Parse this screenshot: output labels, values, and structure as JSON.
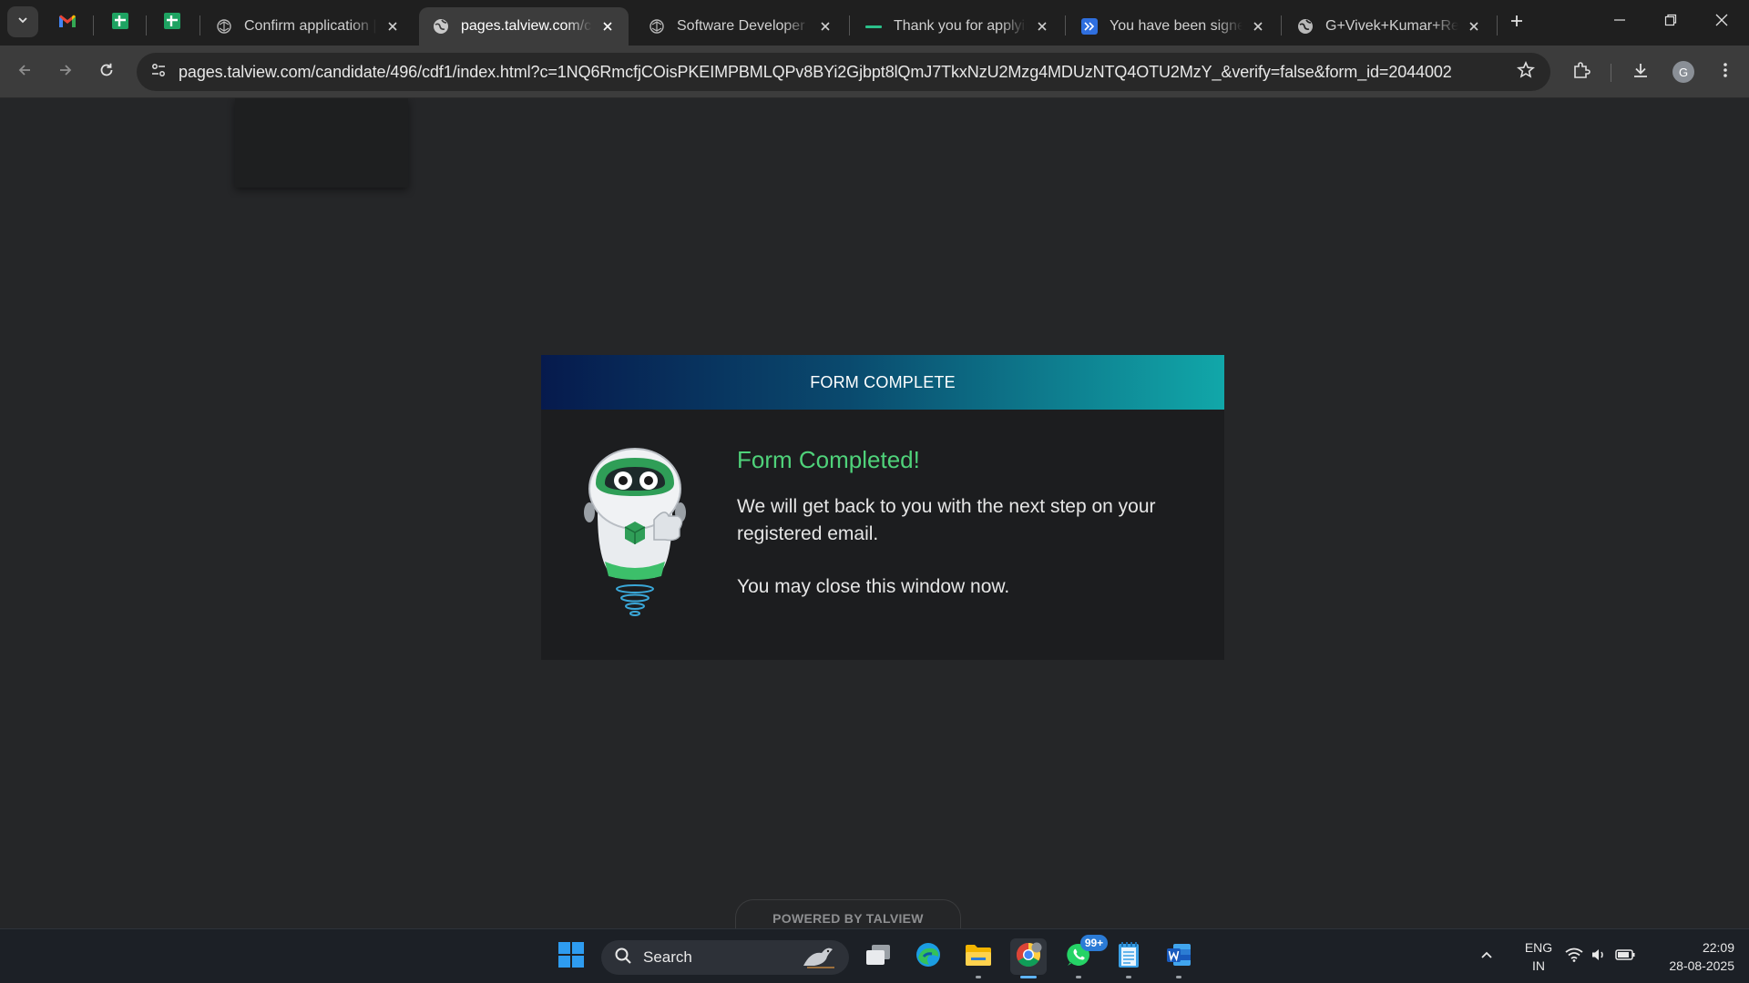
{
  "browser": {
    "tabs": [
      {
        "title": "Confirm application | I",
        "favicon": "brain-network-icon",
        "active": false
      },
      {
        "title": "pages.talview.com/can",
        "favicon": "globe-icon",
        "active": true
      },
      {
        "title": "Software Developer - ",
        "favicon": "brain-network-icon",
        "active": false
      },
      {
        "title": "Thank you for applying",
        "favicon": "dash-line-icon",
        "active": false
      },
      {
        "title": "You have been signed",
        "favicon": "app-blue-icon",
        "active": false
      },
      {
        "title": "G+Vivek+Kumar+Resu",
        "favicon": "globe-icon",
        "active": false
      }
    ],
    "pinned_tabs": [
      "gmail-icon",
      "google-sheets-icon",
      "google-sheets-icon"
    ],
    "url": "pages.talview.com/candidate/496/cdf1/index.html?c=1NQ6RmcfjCOisPKEIMPBMLQPv8BYi2Gjbpt8lQmJ7TkxNzU2Mzg4MDUzNTQ4OTU2MzY_&verify=false&form_id=2044002",
    "profile_initial": "G"
  },
  "page": {
    "card_header": "FORM COMPLETE",
    "title": "Form Completed!",
    "body": "We will get back to you with the next step on your registered email.",
    "close_note": "You may close this window now.",
    "powered_by": "POWERED BY TALVIEW"
  },
  "taskbar": {
    "search_label": "Search",
    "whatsapp_badge": "99+",
    "lang_line1": "ENG",
    "lang_line2": "IN",
    "time": "22:09",
    "date": "28-08-2025"
  },
  "colors": {
    "accent_green": "#4fd27a",
    "header_gradient_start": "#061a4d",
    "header_gradient_end": "#11a7a9",
    "page_background": "#252628"
  }
}
